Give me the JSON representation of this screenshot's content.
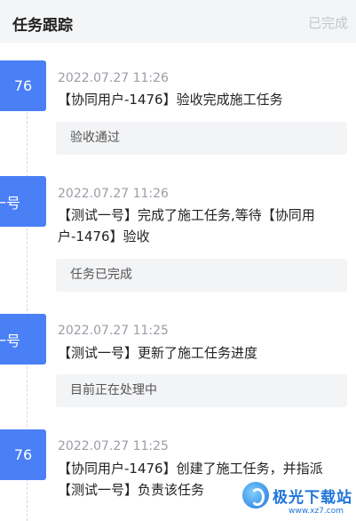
{
  "header": {
    "title": "任务跟踪",
    "status": "已完成"
  },
  "entries": [
    {
      "avatar": "76",
      "time": "2022.07.27 11:26",
      "message": "【协同用户-1476】验收完成施工任务",
      "note": "验收通过"
    },
    {
      "avatar": "一号",
      "time": "2022.07.27 11:26",
      "message": "【测试一号】完成了施工任务,等待【协同用户-1476】验收",
      "note": "任务已完成"
    },
    {
      "avatar": "一号",
      "time": "2022.07.27 11:25",
      "message": "【测试一号】更新了施工任务进度",
      "note": "目前正在处理中"
    },
    {
      "avatar": "76",
      "time": "2022.07.27 11:25",
      "message": "【协同用户-1476】创建了施工任务，并指派【测试一号】负责该任务"
    }
  ],
  "watermark": {
    "text": "极光下载站",
    "url": "www.xz7.com"
  },
  "colors": {
    "avatar_bg": "#4a7ff5",
    "note_bg": "#f3f4f6",
    "header_bg": "#f4f5f7"
  }
}
